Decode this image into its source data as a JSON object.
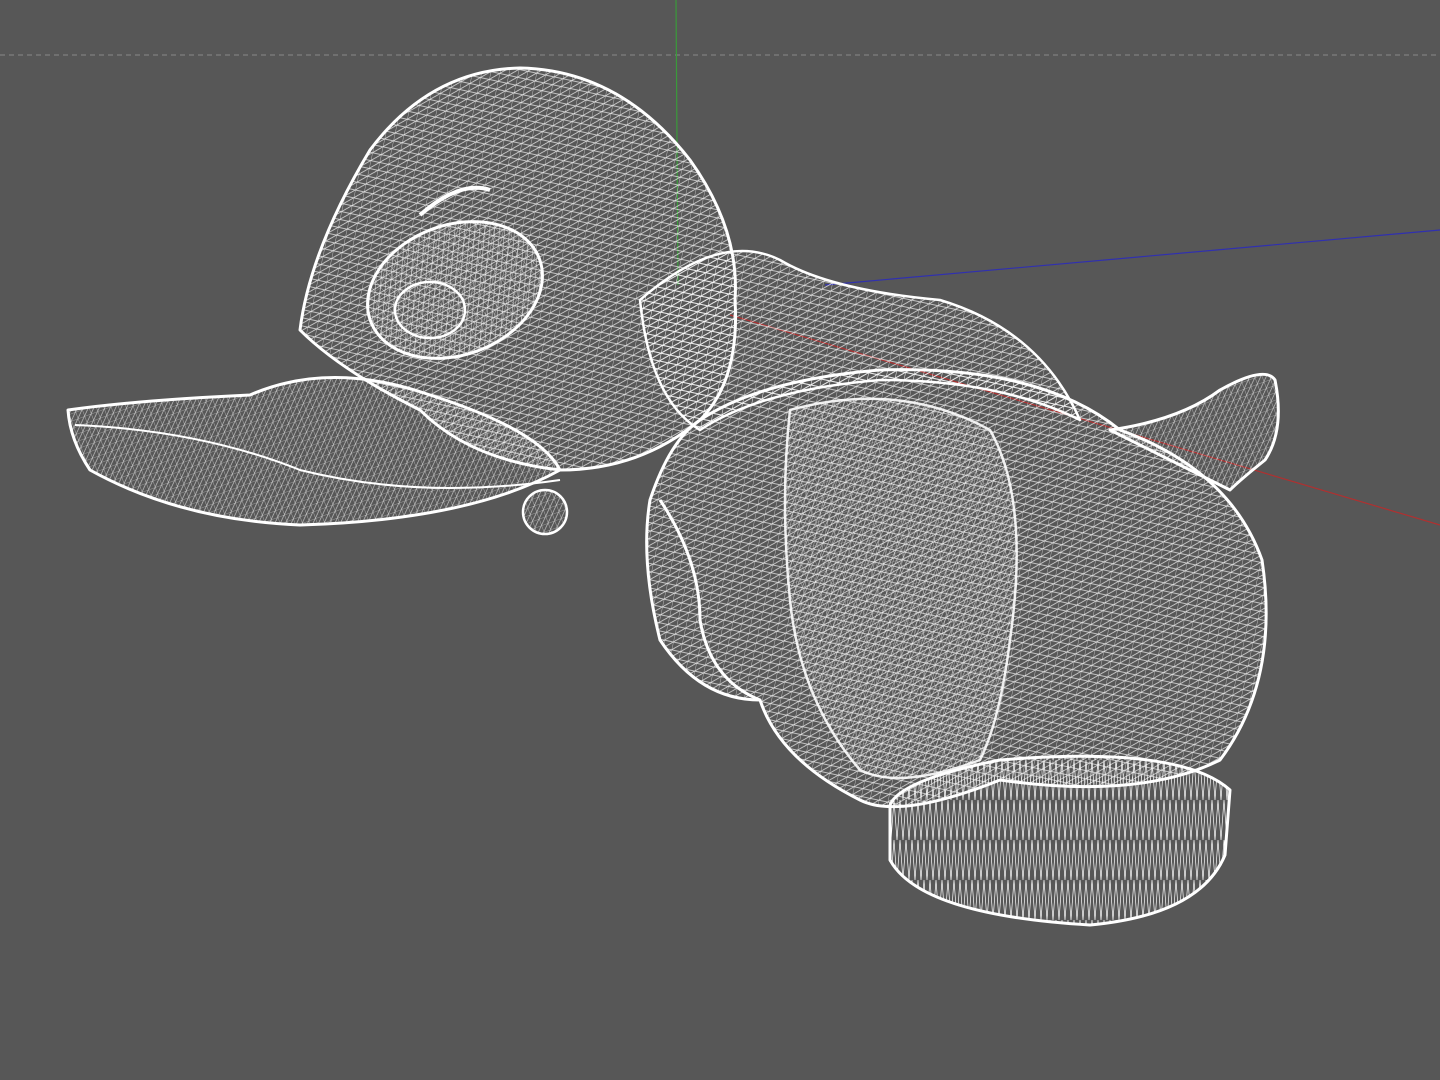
{
  "viewport": {
    "background_color": "#575757",
    "grid_line_color": "#8a8a8a",
    "axis_colors": {
      "x": "#b03030",
      "y": "#3a9a3a",
      "z": "#3030b0"
    },
    "wireframe_color": "#ffffff",
    "model_parts": [
      "head",
      "beak",
      "eye",
      "body",
      "tail",
      "base"
    ]
  }
}
